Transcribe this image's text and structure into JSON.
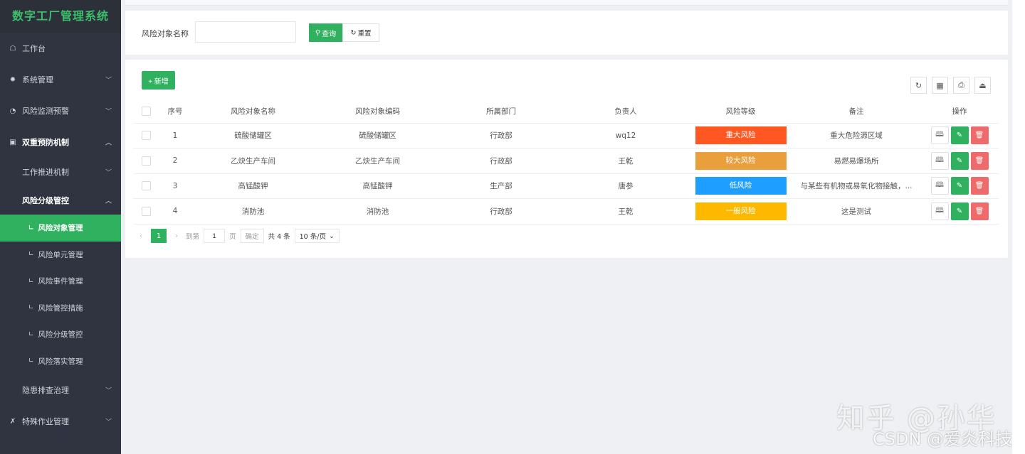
{
  "app": {
    "title": "数字工厂管理系统"
  },
  "sidebar": {
    "items": [
      {
        "icon": "dashboard-icon",
        "glyph": "☖",
        "label": "工作台"
      },
      {
        "icon": "gear-icon",
        "glyph": "✹",
        "label": "系统管理"
      },
      {
        "icon": "monitor-icon",
        "glyph": "◔",
        "label": "风险监测预警"
      },
      {
        "icon": "shield-icon",
        "glyph": "▣",
        "label": "双重预防机制"
      }
    ],
    "sub": [
      {
        "label": "工作推进机制"
      },
      {
        "label": "风险分级管控"
      }
    ],
    "leaves": [
      {
        "label": "风险对象管理"
      },
      {
        "label": "风险单元管理"
      },
      {
        "label": "风险事件管理"
      },
      {
        "label": "风险管控措施"
      },
      {
        "label": "风险分级管控"
      },
      {
        "label": "风险落实管理"
      }
    ],
    "sub2": {
      "label": "隐患排查治理"
    },
    "last": {
      "icon": "tool-icon",
      "glyph": "✗",
      "label": "特殊作业管理"
    }
  },
  "search": {
    "label": "风险对象名称",
    "value": "",
    "query_label": "查询",
    "reset_label": "重置"
  },
  "toolbar": {
    "add_label": "+ 新增"
  },
  "table": {
    "headers": [
      "序号",
      "风险对象名称",
      "风险对象编码",
      "所属部门",
      "负责人",
      "风险等级",
      "备注",
      "操作"
    ],
    "rows": [
      {
        "idx": "1",
        "name": "硫酸储罐区",
        "code": "硫酸储罐区",
        "dept": "行政部",
        "owner": "wq12",
        "level": "重大风险",
        "level_color": "#ff5722",
        "note": "重大危险源区域"
      },
      {
        "idx": "2",
        "name": "乙炔生产车间",
        "code": "乙炔生产车间",
        "dept": "行政部",
        "owner": "王乾",
        "level": "较大风险",
        "level_color": "#e89f3c",
        "note": "易燃易爆场所"
      },
      {
        "idx": "3",
        "name": "高锰酸钾",
        "code": "高锰酸钾",
        "dept": "生产部",
        "owner": "唐参",
        "level": "低风险",
        "level_color": "#1e9fff",
        "note": "与某些有机物或易氧化物接触，..."
      },
      {
        "idx": "4",
        "name": "消防池",
        "code": "消防池",
        "dept": "行政部",
        "owner": "王乾",
        "level": "一般风险",
        "level_color": "#ffb800",
        "note": "这是测试"
      }
    ]
  },
  "pager": {
    "current": "1",
    "goto_label": "到第",
    "page_input": "1",
    "page_unit": "页",
    "confirm_label": "确定",
    "total": "共 4 条",
    "size": "10 条/页"
  },
  "watermark": {
    "zhihu": "知乎 @孙华",
    "csdn": "CSDN @爱炎科技"
  }
}
